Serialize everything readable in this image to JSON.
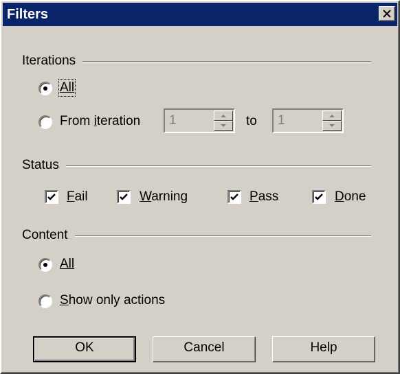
{
  "window": {
    "title": "Filters"
  },
  "iterations": {
    "group_label": "Iterations",
    "all_label": "All",
    "from_label_pre": "From ",
    "from_label_accel": "i",
    "from_label_post": "teration",
    "from_value": "1",
    "to_label": "to",
    "to_value": "1",
    "selected": "all"
  },
  "status": {
    "group_label": "Status",
    "items": [
      {
        "accel": "F",
        "rest": "ail",
        "checked": true
      },
      {
        "accel": "W",
        "rest": "arning",
        "checked": true
      },
      {
        "accel": "P",
        "rest": "ass",
        "checked": true
      },
      {
        "accel": "D",
        "rest": "one",
        "checked": true
      }
    ]
  },
  "content": {
    "group_label": "Content",
    "all_label": "All",
    "show_accel": "S",
    "show_rest": "how only actions",
    "selected": "all"
  },
  "buttons": {
    "ok": "OK",
    "cancel": "Cancel",
    "help": "Help"
  },
  "colors": {
    "titlebar": "#0a246a",
    "face": "#d4d0c8"
  }
}
